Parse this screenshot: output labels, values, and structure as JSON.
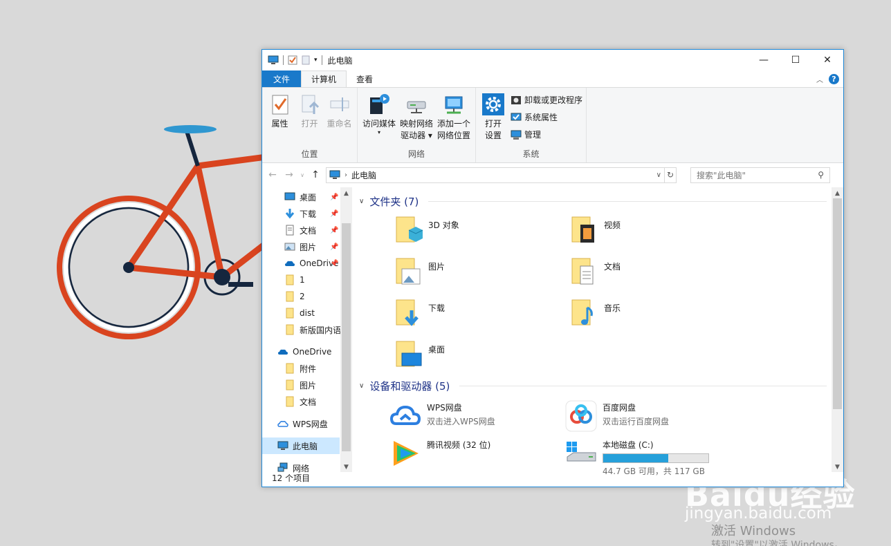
{
  "window": {
    "title": "此电脑",
    "tabs": {
      "file": "文件",
      "computer": "计算机",
      "view": "查看"
    }
  },
  "ribbon": {
    "location": {
      "label": "位置",
      "properties": "属性",
      "open": "打开",
      "rename": "重命名"
    },
    "network": {
      "label": "网络",
      "media": "访问媒体",
      "map_drive_1": "映射网络",
      "map_drive_2": "驱动器",
      "add_loc_1": "添加一个",
      "add_loc_2": "网络位置"
    },
    "system": {
      "label": "系统",
      "settings_1": "打开",
      "settings_2": "设置",
      "uninstall": "卸载或更改程序",
      "sysprops": "系统属性",
      "manage": "管理"
    }
  },
  "address": {
    "crumb": "此电脑",
    "search_placeholder": "搜索\"此电脑\""
  },
  "nav": {
    "quick": [
      {
        "label": "桌面",
        "icon": "desktop-icon"
      },
      {
        "label": "下载",
        "icon": "download-icon"
      },
      {
        "label": "文档",
        "icon": "document-icon"
      },
      {
        "label": "图片",
        "icon": "picture-icon"
      },
      {
        "label": "OneDrive",
        "icon": "onedrive-icon"
      },
      {
        "label": "1",
        "icon": "folder-icon"
      },
      {
        "label": "2",
        "icon": "folder-icon"
      },
      {
        "label": "dist",
        "icon": "folder-icon"
      },
      {
        "label": "新版国内语",
        "icon": "folder-icon"
      }
    ],
    "onedrive": "OneDrive",
    "onedrive_items": [
      "附件",
      "图片",
      "文档"
    ],
    "wps": "WPS网盘",
    "thispc": "此电脑",
    "network": "网络"
  },
  "status": {
    "count": "12 个项目"
  },
  "content": {
    "folders_header": "文件夹 (7)",
    "folders": [
      "3D 对象",
      "视频",
      "图片",
      "文档",
      "下载",
      "音乐",
      "桌面"
    ],
    "devices_header": "设备和驱动器 (5)",
    "devices": {
      "wps_name": "WPS网盘",
      "wps_sub": "双击进入WPS网盘",
      "baidu_name": "百度网盘",
      "baidu_sub": "双击运行百度网盘",
      "tencent_name": "腾讯视频 (32 位)",
      "disk_name": "本地磁盘 (C:)",
      "disk_sub": "44.7 GB 可用，共 117 GB",
      "disk_used_fraction": 0.62
    }
  },
  "watermark": {
    "brand": "Baidu经验",
    "url": "jingyan.baidu.com"
  },
  "activation": {
    "line1": "激活 Windows",
    "line2": "转到\"设置\"以激活 Windows。"
  },
  "colors": {
    "accent": "#1979ca",
    "selection": "#cce8ff",
    "section_header": "#1e3287",
    "bike_frame": "#d9441f"
  }
}
